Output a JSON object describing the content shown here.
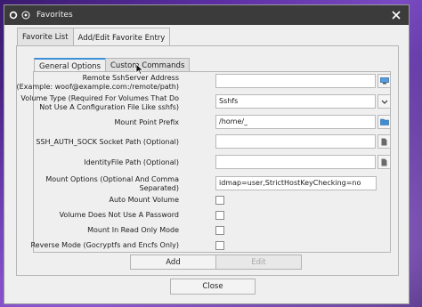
{
  "window": {
    "title": "Favorites"
  },
  "tabs": {
    "outer": [
      "Favorite List",
      "Add/Edit Favorite Entry"
    ],
    "inner": [
      "General Options",
      "Custom Commands"
    ]
  },
  "form": {
    "remote_server": {
      "label_line1": "Remote SshServer Address",
      "label_line2": "(Example: woof@example.com:/remote/path)",
      "value": ""
    },
    "volume_type": {
      "label_line1": "Volume Type (Required For Volumes That Do",
      "label_line2": "Not Use A Configuration File Like sshfs)",
      "value": "Sshfs"
    },
    "mount_point": {
      "label": "Mount Point Prefix",
      "value": "/home/_"
    },
    "ssh_auth_sock": {
      "label": "SSH_AUTH_SOCK Socket Path (Optional)",
      "value": ""
    },
    "identity_file": {
      "label": "IdentityFile Path (Optional)",
      "value": ""
    },
    "mount_options": {
      "label_line1": "Mount Options (Optional And Comma",
      "label_line2": "Separated)",
      "value": "idmap=user,StrictHostKeyChecking=no"
    },
    "checkboxes": [
      {
        "label": "Auto Mount Volume",
        "checked": false
      },
      {
        "label": "Volume Does Not Use A Password",
        "checked": false
      },
      {
        "label": "Mount In Read Only Mode",
        "checked": false
      },
      {
        "label": "Reverse Mode (Gocryptfs and Encfs Only)",
        "checked": false
      }
    ]
  },
  "buttons": {
    "add": "Add",
    "edit": "Edit",
    "close": "Close"
  },
  "icons": {
    "remote_server_button": "network-icon",
    "volume_type_dropdown": "chevron-down-icon",
    "mount_point_button": "folder-icon",
    "ssh_auth_sock_button": "file-icon",
    "identity_file_button": "file-icon"
  }
}
